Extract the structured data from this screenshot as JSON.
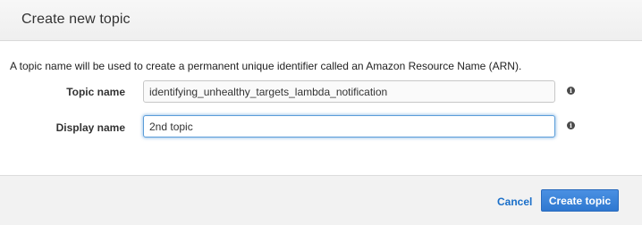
{
  "dialog": {
    "title": "Create new topic",
    "description": "A topic name will be used to create a permanent unique identifier called an Amazon Resource Name (ARN)."
  },
  "fields": {
    "topic_name": {
      "label": "Topic name",
      "value": "identifying_unhealthy_targets_lambda_notification",
      "info_icon": "info-icon"
    },
    "display_name": {
      "label": "Display name",
      "value": "2nd topic",
      "info_icon": "info-icon"
    }
  },
  "footer": {
    "cancel_label": "Cancel",
    "create_label": "Create topic"
  },
  "colors": {
    "primary_button": "#2f78d0",
    "link": "#1a6fc9",
    "focus_border": "#5b9dd9"
  }
}
